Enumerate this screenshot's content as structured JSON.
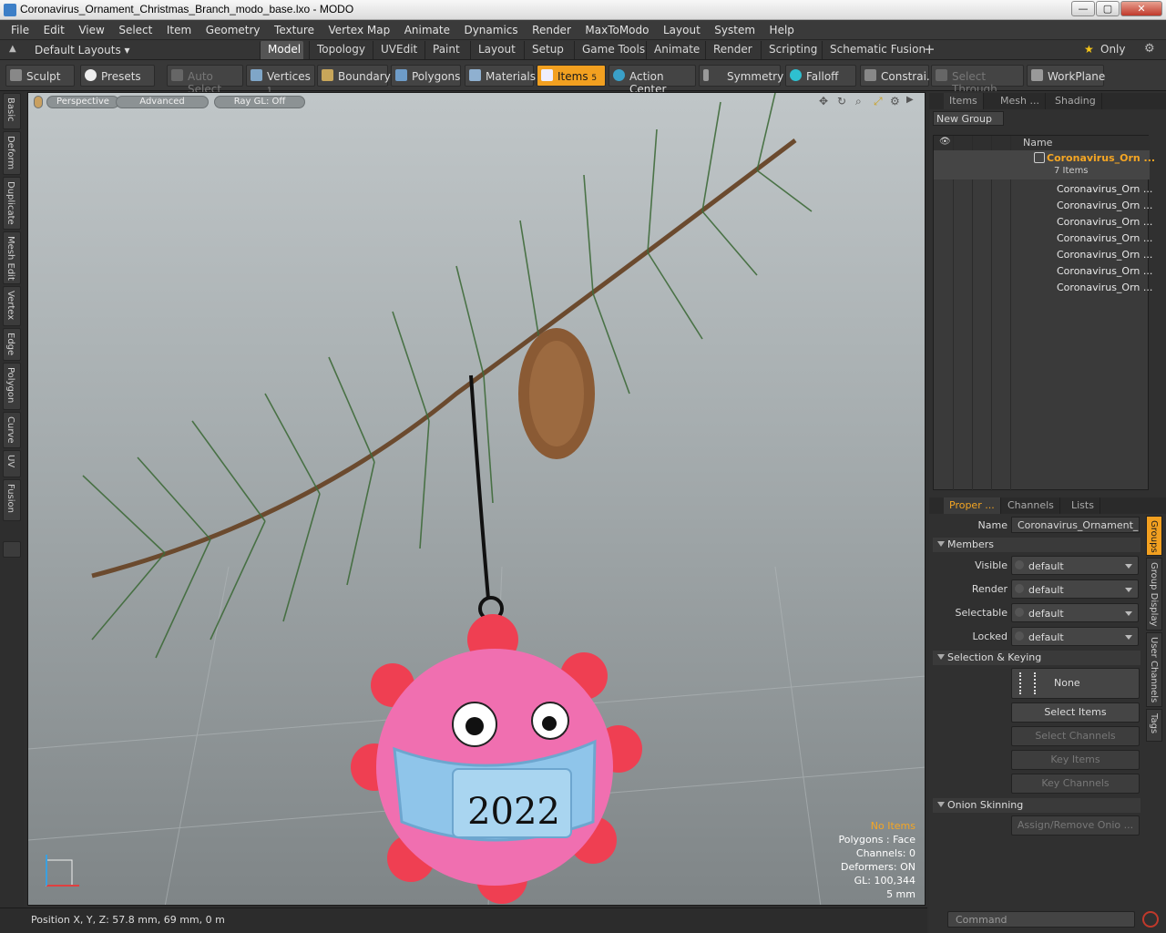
{
  "window": {
    "title": "Coronavirus_Ornament_Christmas_Branch_modo_base.lxo - MODO",
    "min": "—",
    "max": "▢",
    "close": "✕"
  },
  "menu": [
    "File",
    "Edit",
    "View",
    "Select",
    "Item",
    "Geometry",
    "Texture",
    "Vertex Map",
    "Animate",
    "Dynamics",
    "Render",
    "MaxToModo",
    "Layout",
    "System",
    "Help"
  ],
  "tabs": {
    "layout_selector": "Default Layouts ▾",
    "items": [
      "Model",
      "Topology",
      "UVEdit",
      "Paint",
      "Layout",
      "Setup",
      "Game Tools",
      "Animate",
      "Render",
      "Scripting",
      "Schematic Fusion"
    ],
    "add": "+",
    "only": "Only"
  },
  "toolbar": {
    "sculpt": "Sculpt",
    "presets": "Presets",
    "auto_select": "Auto Select",
    "vertices": "Vertices",
    "vertices_count": "1",
    "boundary": "Boundary",
    "polygons": "Polygons",
    "materials": "Materials",
    "items": "Items",
    "items_count": "5",
    "action_center": "Action Center",
    "symmetry": "Symmetry",
    "falloff": "Falloff",
    "constraints": "Constrai...",
    "select_through": "Select Through",
    "workplane": "WorkPlane"
  },
  "left_tabs": [
    "Basic",
    "Deform",
    "Duplicate",
    "Mesh Edit",
    "Vertex",
    "Edge",
    "Polygon",
    "Curve",
    "UV",
    "Fusion"
  ],
  "viewport": {
    "perspective": "Perspective",
    "advanced": "Advanced",
    "raygl": "Ray GL: Off",
    "ornament_text": "2022",
    "stats": {
      "selection": "No Items",
      "polygons": "Polygons : Face",
      "channels": "Channels: 0",
      "deformers": "Deformers: ON",
      "gl": "GL: 100,344",
      "scale": "5 mm"
    }
  },
  "status": {
    "position": "Position X, Y, Z:   57.8 mm, 69 mm, 0 m",
    "command_placeholder": "Command"
  },
  "items_panel": {
    "tabs": [
      "Items",
      "Mesh ...",
      "Shading"
    ],
    "new_group": "New Group",
    "name_header": "Name",
    "group": {
      "name": "Coronavirus_Orn ...",
      "count": "7 Items"
    },
    "children": [
      "Coronavirus_Orn ...",
      "Coronavirus_Orn ...",
      "Coronavirus_Orn ...",
      "Coronavirus_Orn ...",
      "Coronavirus_Orn ...",
      "Coronavirus_Orn ...",
      "Coronavirus_Orn ..."
    ]
  },
  "properties": {
    "tabs": [
      "Proper ...",
      "Channels",
      "Lists"
    ],
    "name_label": "Name",
    "name_value": "Coronavirus_Ornament_Ch",
    "members": "Members",
    "visible": "Visible",
    "render": "Render",
    "selectable": "Selectable",
    "locked": "Locked",
    "default": "default",
    "selection_keying": "Selection & Keying",
    "none": "None",
    "select_items": "Select Items",
    "select_channels": "Select Channels",
    "key_items": "Key Items",
    "key_channels": "Key Channels",
    "onion": "Onion Skinning",
    "assign": "Assign/Remove Onio ...",
    "side_tabs": [
      "Groups",
      "Group Display",
      "User Channels",
      "Tags"
    ]
  }
}
